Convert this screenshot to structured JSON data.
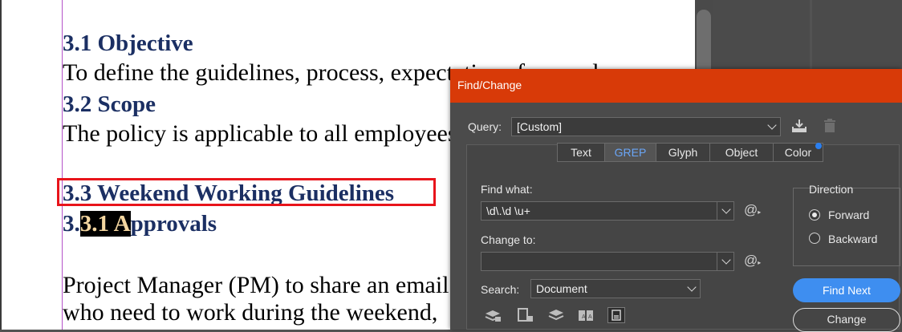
{
  "document": {
    "heading_objective": "3.1 Objective",
    "text_objective": "To define the guidelines, process, expectations for employees",
    "heading_scope": "3.2 Scope",
    "text_scope": "The policy is applicable to all employees",
    "heading_weekend": "3.3 Weekend Working Guidelines",
    "heading_approvals_prefix": "3.",
    "heading_approvals_selected": "3.1 A",
    "heading_approvals_suffix": "pprovals",
    "para_line1": "Project Manager (PM) to share an email",
    "para_line2": "who need to work during the weekend,"
  },
  "dialog": {
    "title": "Find/Change",
    "query_label": "Query:",
    "query_value": "[Custom]",
    "tabs": [
      "Text",
      "GREP",
      "Glyph",
      "Object",
      "Color"
    ],
    "active_tab": "GREP",
    "find_what_label": "Find what:",
    "find_what_value": "\\d\\.\\d \\u+",
    "change_to_label": "Change to:",
    "change_to_value": "",
    "search_label": "Search:",
    "search_value": "Document",
    "direction_label": "Direction",
    "direction_options": [
      "Forward",
      "Backward"
    ],
    "direction_selected": "Forward",
    "find_next_label": "Find Next",
    "change_label": "Change",
    "special_char_symbol": "@"
  },
  "colors": {
    "titlebar": "#d83a08",
    "heading_text": "#1b2f63",
    "highlight_box": "#e8141b",
    "primary_button": "#3e8ef0",
    "active_tab_text": "#6aa6f7"
  }
}
